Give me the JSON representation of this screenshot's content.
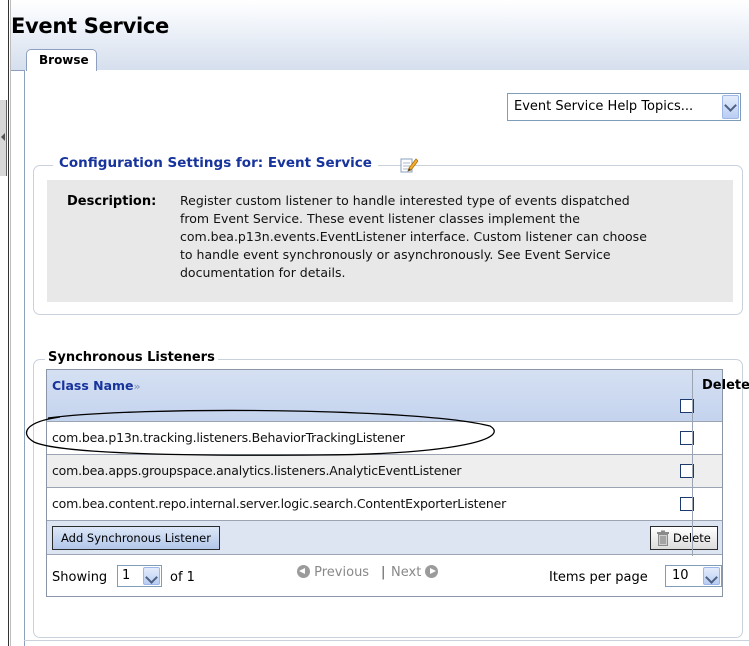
{
  "header": {
    "title": "Event Service",
    "tabs": [
      {
        "label": "Browse",
        "active": true
      }
    ]
  },
  "help": {
    "selected": "Event Service Help Topics..."
  },
  "config": {
    "legend": "Configuration Settings for: Event Service",
    "edit_icon": "edit-pencil-icon",
    "description_label": "Description:",
    "description_lines": [
      "Register custom listener to handle interested type of events dispatched",
      "from Event Service. These event listener classes implement the",
      "com.bea.p13n.events.EventListener interface. Custom listener can choose",
      "to handle event synchronously or asynchronously. See Event Service",
      "documentation for details."
    ]
  },
  "listeners": {
    "legend": "Synchronous Listeners",
    "columns": {
      "class_name": "Class Name",
      "delete": "Delete"
    },
    "sort_icon": "double-chevron-right-icon",
    "rows": [
      {
        "class_name": "com.bea.p13n.tracking.listeners.BehaviorTrackingListener",
        "checked": false
      },
      {
        "class_name": "com.bea.apps.groupspace.analytics.listeners.AnalyticEventListener",
        "checked": false
      },
      {
        "class_name": "com.bea.content.repo.internal.server.logic.search.ContentExporterListener",
        "checked": false
      }
    ],
    "add_button": "Add Synchronous Listener",
    "delete_button": "Delete",
    "trash_icon": "trash-icon"
  },
  "pager": {
    "showing_label": "Showing",
    "page": "1",
    "of_label": "of 1",
    "previous": "Previous",
    "separator": "|",
    "next": "Next",
    "items_label": "Items per page",
    "per_page": "10"
  },
  "colors": {
    "link_blue": "#17339c",
    "header_gradient_end": "#d6dfee",
    "table_header": "#c4d3ee",
    "description_bg": "#e8e8e8"
  }
}
